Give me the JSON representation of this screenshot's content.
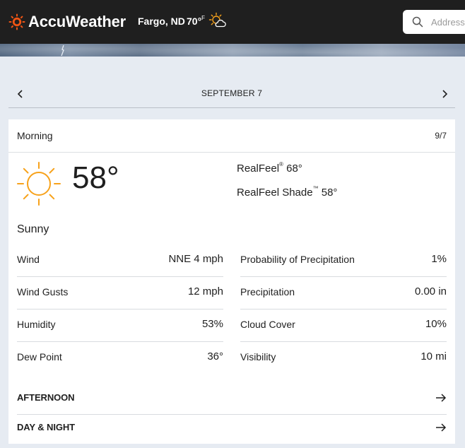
{
  "header": {
    "brand": "AccuWeather",
    "location": "Fargo, ND",
    "current_temp": "70°",
    "current_temp_unit": "F",
    "weather_icon": "partly-cloudy-sun-icon",
    "search": {
      "placeholder": "Address",
      "icon": "search-icon"
    }
  },
  "date_nav": {
    "label": "SEPTEMBER 7",
    "prev_icon": "chevron-left-icon",
    "next_icon": "chevron-right-icon"
  },
  "card": {
    "title": "Morning",
    "date": "9/7",
    "icon": "sun-icon",
    "temperature": "58°",
    "realfeel_label": "RealFeel",
    "realfeel_mark": "®",
    "realfeel_value": "68°",
    "realfeel_shade_label": "RealFeel Shade",
    "realfeel_shade_mark": "™",
    "realfeel_shade_value": "58°",
    "phrase": "Sunny",
    "details_left": [
      {
        "label": "Wind",
        "value": "NNE 4 mph"
      },
      {
        "label": "Wind Gusts",
        "value": "12 mph"
      },
      {
        "label": "Humidity",
        "value": "53%"
      },
      {
        "label": "Dew Point",
        "value": "36°"
      }
    ],
    "details_right": [
      {
        "label": "Probability of Precipitation",
        "value": "1%"
      },
      {
        "label": "Precipitation",
        "value": "0.00 in"
      },
      {
        "label": "Cloud Cover",
        "value": "10%"
      },
      {
        "label": "Visibility",
        "value": "10 mi"
      }
    ],
    "links": [
      {
        "label": "AFTERNOON",
        "icon": "arrow-right-icon"
      },
      {
        "label": "DAY & NIGHT",
        "icon": "arrow-right-icon"
      }
    ]
  },
  "colors": {
    "header_bg": "#1f1f1f",
    "brand_orange": "#f05514",
    "sun_orange": "#f7a21b",
    "page_bg": "#e6ebf2"
  }
}
